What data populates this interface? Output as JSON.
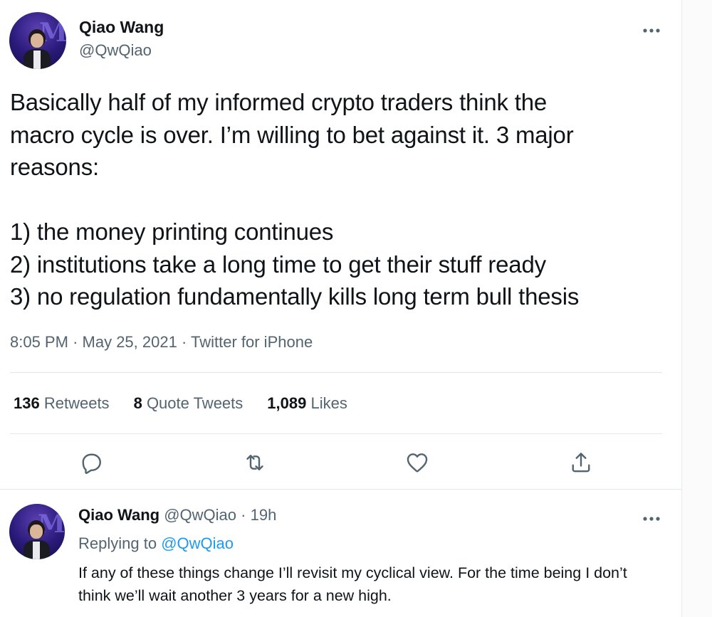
{
  "tweet": {
    "author_name": "Qiao Wang",
    "author_handle": "@QwQiao",
    "text": "Basically half of my informed crypto traders think the\nmacro cycle is over.  I’m willing to bet against it. 3 major\nreasons:\n\n1) the money printing continues\n2) institutions take a long time to get their stuff ready\n3) no regulation fundamentally kills long term bull thesis",
    "time": "8:05 PM",
    "date": "May 25, 2021",
    "source": "Twitter for iPhone",
    "separator": "·"
  },
  "stats": {
    "retweets_count": "136",
    "retweets_label": "Retweets",
    "quote_count": "8",
    "quote_label": "Quote Tweets",
    "likes_count": "1,089",
    "likes_label": "Likes"
  },
  "actions": {
    "icons": [
      "reply-icon",
      "retweet-icon",
      "like-icon",
      "share-icon"
    ],
    "color": "#536471"
  },
  "reply": {
    "author_name": "Qiao Wang",
    "author_handle": "@QwQiao",
    "age": "19h",
    "separator": "·",
    "replying_label": "Replying to",
    "replying_to": "@QwQiao",
    "text": "If any of these things change I’ll revisit my cyclical view. For the time being I don’t think we’ll wait another 3 years for a new high."
  },
  "colors": {
    "link": "#1d9bf0",
    "secondary_text": "#536471",
    "primary_text": "#0f1419",
    "divider": "#e1e8ed"
  }
}
